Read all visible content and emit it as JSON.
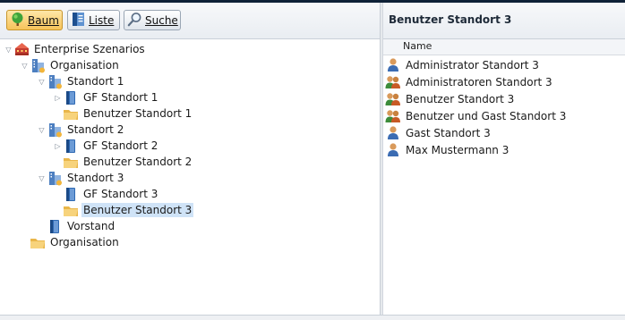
{
  "toolbar": {
    "baum_label": "Baum",
    "liste_label": "Liste",
    "suche_label": "Suche"
  },
  "tree": [
    {
      "label": "Enterprise Szenarios",
      "icon": "enterprise-icon",
      "twisty": "expanded"
    },
    {
      "label": "Organisation",
      "icon": "organisation-icon",
      "twisty": "expanded"
    },
    {
      "label": "Standort 1",
      "icon": "standort-icon",
      "twisty": "expanded"
    },
    {
      "label": "GF Standort 1",
      "icon": "book-icon",
      "twisty": "collapsed"
    },
    {
      "label": "Benutzer Standort 1",
      "icon": "folder-icon",
      "twisty": "none"
    },
    {
      "label": "Standort 2",
      "icon": "standort-icon",
      "twisty": "expanded"
    },
    {
      "label": "GF Standort 2",
      "icon": "book-icon",
      "twisty": "collapsed"
    },
    {
      "label": "Benutzer Standort 2",
      "icon": "folder-icon",
      "twisty": "none"
    },
    {
      "label": "Standort 3",
      "icon": "standort-icon",
      "twisty": "expanded"
    },
    {
      "label": "GF Standort 3",
      "icon": "book-icon",
      "twisty": "none"
    },
    {
      "label": "Benutzer Standort 3",
      "icon": "folder-icon",
      "twisty": "none",
      "selected": true
    },
    {
      "label": "Vorstand",
      "icon": "book-icon",
      "twisty": "none"
    },
    {
      "label": "Organisation",
      "icon": "folder-icon",
      "twisty": "none"
    }
  ],
  "details": {
    "title": "Benutzer Standort 3",
    "column_name": "Name",
    "items": [
      {
        "label": "Administrator Standort 3",
        "icon": "user-icon"
      },
      {
        "label": "Administratoren Standort 3",
        "icon": "user-group-icon"
      },
      {
        "label": "Benutzer Standort 3",
        "icon": "user-group-icon"
      },
      {
        "label": "Benutzer und Gast Standort 3",
        "icon": "user-group-icon"
      },
      {
        "label": "Gast Standort 3",
        "icon": "user-icon"
      },
      {
        "label": "Max Mustermann 3",
        "icon": "user-icon"
      }
    ]
  },
  "colors": {
    "selection": "#cfe3f7",
    "active_button": "#f6c35a",
    "top_bar": "#0f2137"
  }
}
